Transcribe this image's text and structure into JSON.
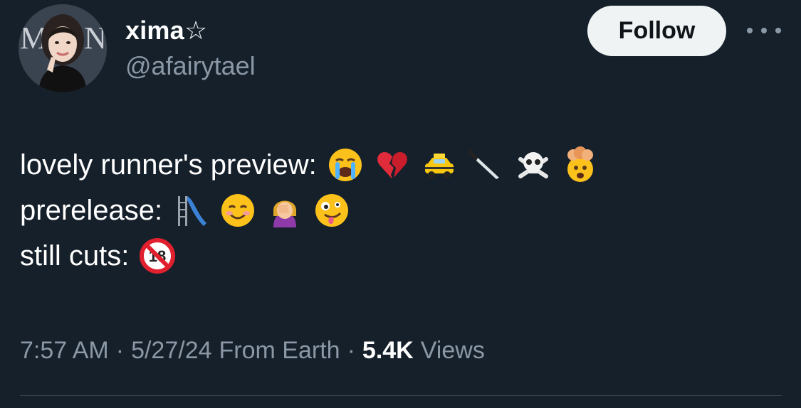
{
  "author": {
    "display_name": "xima☆",
    "handle": "@afairytael",
    "avatar_icon": "profile-photo"
  },
  "actions": {
    "follow_label": "Follow",
    "more_icon": "more-horizontal-icon"
  },
  "tweet": {
    "lines": [
      {
        "text": "lovely runner's preview:",
        "emojis": [
          "loudly-crying-face",
          "broken-heart",
          "taxi",
          "kitchen-knife",
          "skull-and-crossbones",
          "exploding-head"
        ]
      },
      {
        "text": "prerelease:",
        "emojis": [
          "playground-slide",
          "smiling-face",
          "woman-facepalming",
          "zany-face"
        ]
      },
      {
        "text": "still cuts:",
        "emojis": [
          "no-one-under-eighteen"
        ]
      }
    ]
  },
  "meta": {
    "time": "7:57 AM",
    "date": "5/27/24",
    "source": "From Earth",
    "separator": "·",
    "views_count": "5.4K",
    "views_label": "Views"
  },
  "colors": {
    "background": "#15202b",
    "primary_text": "#ffffff",
    "secondary_text": "#8b98a5",
    "follow_bg": "#eff3f4",
    "divider": "#38444d"
  }
}
